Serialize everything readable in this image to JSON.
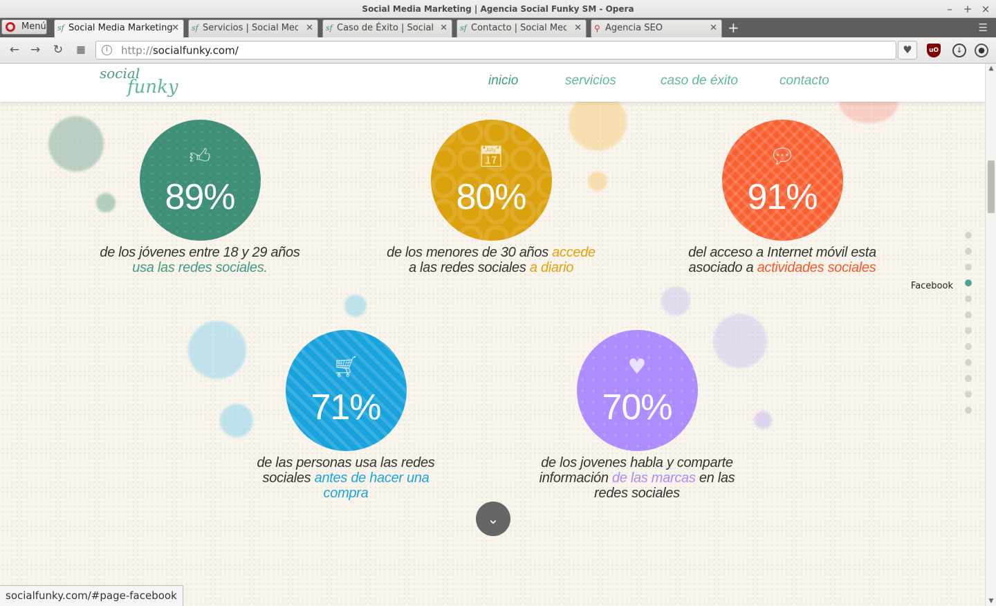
{
  "window": {
    "title": "Social Media Marketing | Agencia Social Funky SM - Opera"
  },
  "browser": {
    "menu_label": "Menú",
    "tabs": [
      {
        "label": "Social Media Marketing",
        "icon": "sf-favicon"
      },
      {
        "label": "Servicios | Social Media",
        "icon": "sf-favicon"
      },
      {
        "label": "Caso de Éxito | Social M",
        "icon": "sf-favicon"
      },
      {
        "label": "Contacto | Social Media",
        "icon": "sf-favicon"
      },
      {
        "label": "Agencia SEO",
        "icon": "map-pin-favicon"
      }
    ],
    "url_protocol": "http://",
    "url_host": "socialfunky.com/",
    "status_url": "socialfunky.com/#page-facebook"
  },
  "site": {
    "logo_line1": "social",
    "logo_line2": "funky",
    "nav": [
      {
        "label": "inicio"
      },
      {
        "label": "servicios"
      },
      {
        "label": "caso de éxito"
      },
      {
        "label": "contacto"
      }
    ],
    "stats": [
      {
        "value": "89%",
        "icon": "thumbs-up-icon",
        "color": "#3f8f79",
        "text": "de los jóvenes entre 18 y 29 años",
        "highlight": "usa las redes sociales."
      },
      {
        "value": "80%",
        "icon": "calendar-icon",
        "color": "#dca20e",
        "text_a": "de los menores de 30 años",
        "highlight_a": "accede",
        "text_b": "a las redes sociales",
        "highlight_b": "a diario"
      },
      {
        "value": "91%",
        "icon": "chat-bubbles-icon",
        "color": "#f86032",
        "text_a": "del acceso a Internet móvil esta",
        "text_b": "asociado a",
        "highlight": "actividades sociales"
      },
      {
        "value": "71%",
        "icon": "shopping-cart-icon",
        "color": "#19a3dc",
        "text_a": "de las personas usa las redes",
        "text_b": "sociales",
        "highlight": "antes de hacer una compra"
      },
      {
        "value": "70%",
        "icon": "heart-icon",
        "color": "#ad8dff",
        "text_a": "de los jovenes habla y comparte",
        "text_b": "información",
        "highlight": "de las marcas",
        "text_c": "en las redes sociales"
      }
    ],
    "side_nav": {
      "active_label": "Facebook",
      "count": 12,
      "active_index": 3
    }
  }
}
